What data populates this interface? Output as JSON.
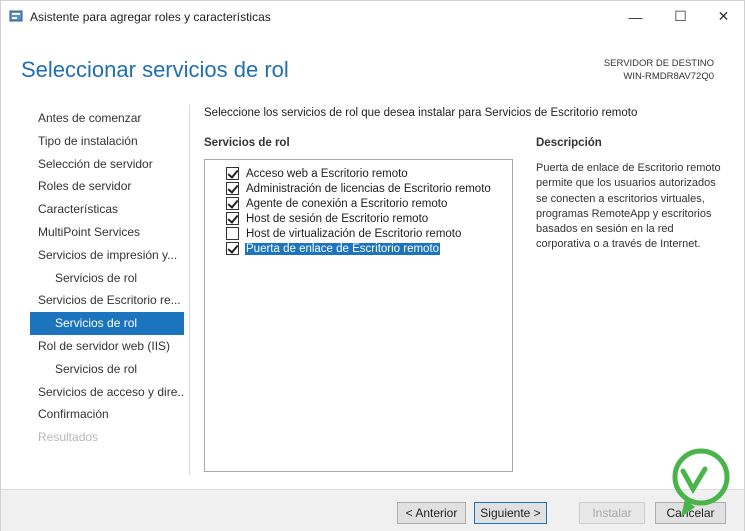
{
  "window": {
    "title": "Asistente para agregar roles y características",
    "minimize_glyph": "—",
    "maximize_glyph": "☐",
    "close_glyph": "✕"
  },
  "header": {
    "page_title": "Seleccionar servicios de rol",
    "dest_label": "SERVIDOR DE DESTINO",
    "dest_server": "WIN-RMDR8AV72Q0"
  },
  "nav": {
    "items": [
      {
        "label": "Antes de comenzar",
        "state": "normal"
      },
      {
        "label": "Tipo de instalación",
        "state": "normal"
      },
      {
        "label": "Selección de servidor",
        "state": "normal"
      },
      {
        "label": "Roles de servidor",
        "state": "normal"
      },
      {
        "label": "Características",
        "state": "normal"
      },
      {
        "label": "MultiPoint Services",
        "state": "normal"
      },
      {
        "label": "Servicios de impresión y...",
        "state": "normal"
      },
      {
        "label": "Servicios de rol",
        "state": "sub"
      },
      {
        "label": "Servicios de Escritorio re...",
        "state": "normal"
      },
      {
        "label": "Servicios de rol",
        "state": "active"
      },
      {
        "label": "Rol de servidor web (IIS)",
        "state": "normal"
      },
      {
        "label": "Servicios de rol",
        "state": "sub"
      },
      {
        "label": "Servicios de acceso y dire...",
        "state": "normal"
      },
      {
        "label": "Confirmación",
        "state": "normal"
      },
      {
        "label": "Resultados",
        "state": "disabled"
      }
    ]
  },
  "main": {
    "instruction": "Seleccione los servicios de rol que desea instalar para Servicios de Escritorio remoto",
    "services_header": "Servicios de rol",
    "description_header": "Descripción",
    "services": [
      {
        "label": "Acceso web a Escritorio remoto",
        "checked": true,
        "selected": false
      },
      {
        "label": "Administración de licencias de Escritorio remoto",
        "checked": true,
        "selected": false
      },
      {
        "label": "Agente de conexión a Escritorio remoto",
        "checked": true,
        "selected": false
      },
      {
        "label": "Host de sesión de Escritorio remoto",
        "checked": true,
        "selected": false
      },
      {
        "label": "Host de virtualización de Escritorio remoto",
        "checked": false,
        "selected": false
      },
      {
        "label": "Puerta de enlace de Escritorio remoto",
        "checked": true,
        "selected": true
      }
    ],
    "description": "Puerta de enlace de Escritorio remoto permite que los usuarios autorizados se conecten a escritorios virtuales, programas RemoteApp y escritorios basados en sesión en la red corporativa o a través de Internet."
  },
  "footer": {
    "prev_label": "< Anterior",
    "next_label": "Siguiente >",
    "install_label": "Instalar",
    "cancel_label": "Cancelar"
  },
  "colors": {
    "accent": "#1c74bf",
    "title": "#1f6fb2",
    "watermark": "#4ab34a"
  }
}
